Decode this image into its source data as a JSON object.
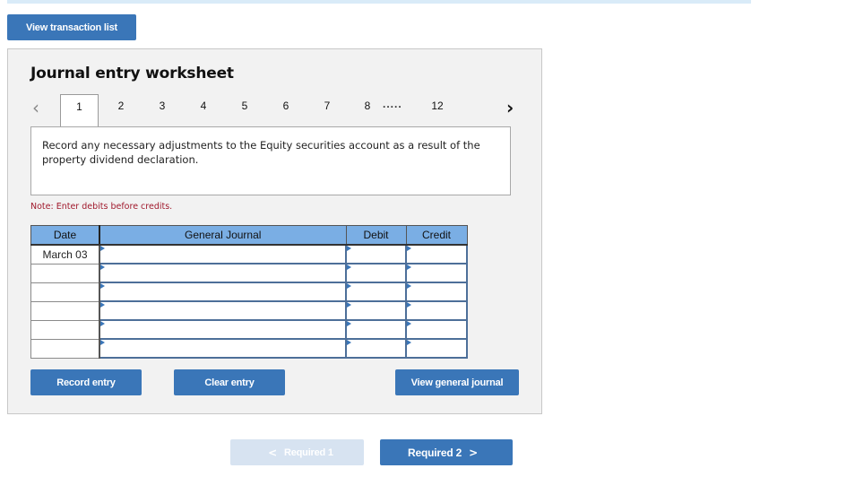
{
  "top_bar": {
    "color": "#d9ebf8"
  },
  "toolbar": {
    "view_transaction_list": "View transaction list"
  },
  "worksheet": {
    "title": "Journal entry worksheet",
    "pager": {
      "prev_icon": "chevron-left-icon",
      "next_icon": "chevron-right-icon",
      "pages": [
        "1",
        "2",
        "3",
        "4",
        "5",
        "6",
        "7",
        "8",
        "12"
      ],
      "active_page": "1",
      "ellipsis": "....."
    },
    "instruction": "Record any necessary adjustments to the Equity securities account as a result of the property dividend declaration.",
    "note": "Note: Enter debits before credits.",
    "table": {
      "headers": {
        "date": "Date",
        "general_journal": "General Journal",
        "debit": "Debit",
        "credit": "Credit"
      },
      "rows": [
        {
          "date": "March 03",
          "general_journal": "",
          "debit": "",
          "credit": ""
        },
        {
          "date": "",
          "general_journal": "",
          "debit": "",
          "credit": ""
        },
        {
          "date": "",
          "general_journal": "",
          "debit": "",
          "credit": ""
        },
        {
          "date": "",
          "general_journal": "",
          "debit": "",
          "credit": ""
        },
        {
          "date": "",
          "general_journal": "",
          "debit": "",
          "credit": ""
        },
        {
          "date": "",
          "general_journal": "",
          "debit": "",
          "credit": ""
        }
      ]
    },
    "buttons": {
      "record_entry": "Record entry",
      "clear_entry": "Clear entry",
      "view_general_journal": "View general journal"
    }
  },
  "nav": {
    "prev_label": "Required 1",
    "prev_disabled": true,
    "next_label": "Required 2",
    "prev_icon": "<",
    "next_icon": ">"
  },
  "colors": {
    "primary_button": "#3a76b8",
    "disabled_button": "#d7e3f1",
    "table_header": "#7aaee4",
    "note_text": "#a0192c",
    "panel_bg": "#f2f2f2"
  }
}
